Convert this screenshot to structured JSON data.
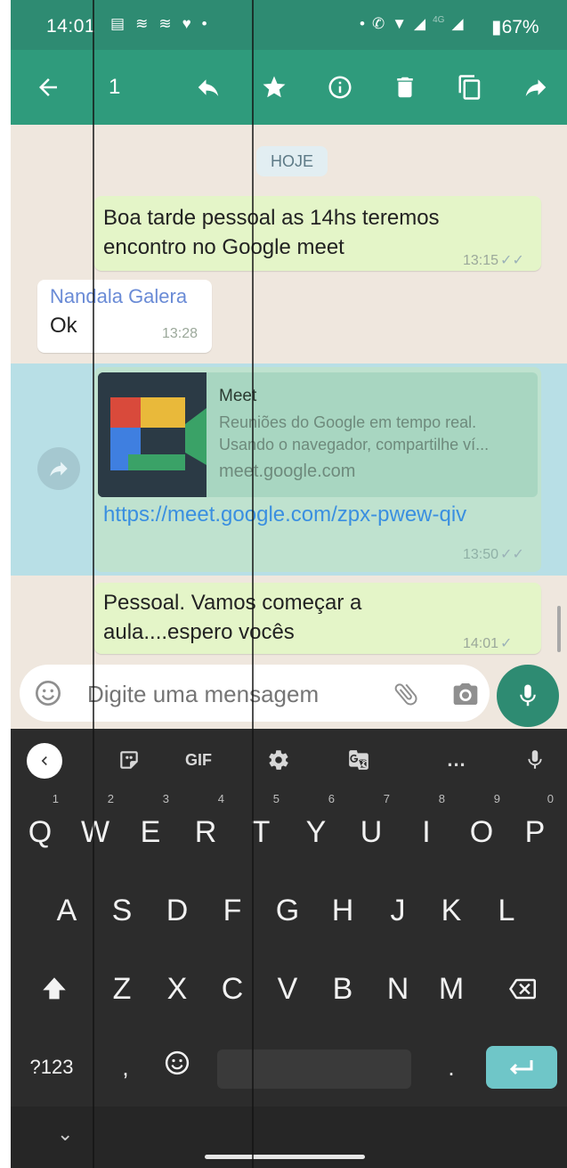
{
  "status_bar": {
    "time": "14:01",
    "left_icons": [
      "news-icon",
      "whatsapp-icon",
      "whatsapp-icon",
      "heart-icon",
      "dot-icon"
    ],
    "network": "4G",
    "network2": "4G",
    "battery": "67%"
  },
  "toolbar": {
    "selected_count": "1",
    "actions": [
      "back-icon",
      "reply-icon",
      "star-icon",
      "info-icon",
      "delete-icon",
      "copy-icon",
      "forward-icon"
    ]
  },
  "chat": {
    "date_label": "HOJE",
    "messages": [
      {
        "text": "Boa tarde pessoal as 14hs teremos encontro no Google meet",
        "time": "13:15",
        "status": "read"
      },
      {
        "sender": "Nandala Galera",
        "text": "Ok",
        "time": "13:28"
      },
      {
        "link_preview": {
          "title": "Meet",
          "description": "Reuniões do Google em tempo real. Usando o navegador, compartilhe ví...",
          "domain": "meet.google.com"
        },
        "text": "https://meet.google.com/zpx-pwew-qiv",
        "time": "13:50",
        "status": "read",
        "selected": true
      },
      {
        "text": "Pessoal.  Vamos começar a aula....espero vocês",
        "time": "14:01",
        "status": "sent"
      }
    ]
  },
  "input": {
    "placeholder": "Digite uma mensagem"
  },
  "keyboard": {
    "toolbar": [
      "back-icon",
      "sticker-icon",
      "GIF",
      "settings-icon",
      "translate-icon",
      "...",
      "mic-icon"
    ],
    "gif_label": "GIF",
    "more_label": "...",
    "row1": [
      {
        "key": "Q",
        "num": "1"
      },
      {
        "key": "W",
        "num": "2"
      },
      {
        "key": "E",
        "num": "3"
      },
      {
        "key": "R",
        "num": "4"
      },
      {
        "key": "T",
        "num": "5"
      },
      {
        "key": "Y",
        "num": "6"
      },
      {
        "key": "U",
        "num": "7"
      },
      {
        "key": "I",
        "num": "8"
      },
      {
        "key": "O",
        "num": "9"
      },
      {
        "key": "P",
        "num": "0"
      }
    ],
    "row2": [
      "A",
      "S",
      "D",
      "F",
      "G",
      "H",
      "J",
      "K",
      "L"
    ],
    "row3": [
      "Z",
      "X",
      "C",
      "V",
      "B",
      "N",
      "M"
    ],
    "symbols_label": "?123",
    "comma_label": ","
  }
}
